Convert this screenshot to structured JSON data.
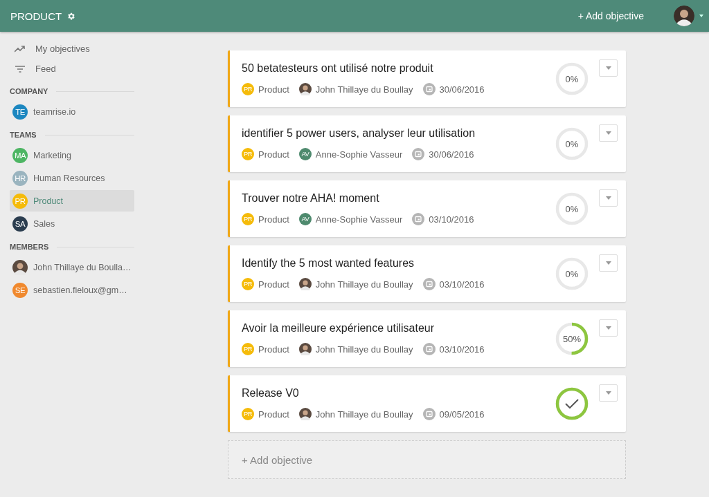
{
  "header": {
    "title": "PRODUCT",
    "add_button": "+ Add objective"
  },
  "sidebar": {
    "nav": [
      {
        "kind": "trend",
        "label": "My objectives"
      },
      {
        "kind": "filter",
        "label": "Feed"
      }
    ],
    "sections": [
      {
        "title": "COMPANY",
        "items": [
          {
            "kind": "initials",
            "initials": "TE",
            "color": "#1c87c0",
            "label": "teamrise.io",
            "selected": false
          }
        ]
      },
      {
        "title": "TEAMS",
        "items": [
          {
            "kind": "initials",
            "initials": "MA",
            "color": "#4db563",
            "label": "Marketing",
            "selected": false
          },
          {
            "kind": "initials",
            "initials": "HR",
            "color": "#9ab4bf",
            "label": "Human Resources",
            "selected": false
          },
          {
            "kind": "initials",
            "initials": "PR",
            "color": "#f5bb0a",
            "label": "Product",
            "selected": true
          },
          {
            "kind": "initials",
            "initials": "SA",
            "color": "#2b3d4f",
            "label": "Sales",
            "selected": false
          }
        ]
      },
      {
        "title": "MEMBERS",
        "items": [
          {
            "kind": "photo",
            "label": "John Thillaye du Boulla…",
            "selected": false
          },
          {
            "kind": "initials",
            "initials": "SE",
            "color": "#f0892e",
            "label": "sebastien.fieloux@gm…",
            "selected": false
          }
        ]
      }
    ]
  },
  "objectives": [
    {
      "title": "50 betatesteurs ont utilisé notre produit",
      "team": {
        "initials": "PR",
        "color": "#f5bb0a",
        "label": "Product"
      },
      "owner": {
        "kind": "photo",
        "label": "John Thillaye du Boullay"
      },
      "date": "30/06/2016",
      "complete": false,
      "level": 0,
      "reading": "0%"
    },
    {
      "title": "identifier 5 power users, analyser leur utilisation",
      "team": {
        "initials": "PR",
        "color": "#f5bb0a",
        "label": "Product"
      },
      "owner": {
        "kind": "initials",
        "initials": "AV",
        "color": "#4e8a6e",
        "label": "Anne-Sophie Vasseur"
      },
      "date": "30/06/2016",
      "complete": false,
      "level": 0,
      "reading": "0%"
    },
    {
      "title": "Trouver notre AHA! moment",
      "team": {
        "initials": "PR",
        "color": "#f5bb0a",
        "label": "Product"
      },
      "owner": {
        "kind": "initials",
        "initials": "AV",
        "color": "#4e8a6e",
        "label": "Anne-Sophie Vasseur"
      },
      "date": "03/10/2016",
      "complete": false,
      "level": 0,
      "reading": "0%"
    },
    {
      "title": "Identify the 5 most wanted features",
      "team": {
        "initials": "PR",
        "color": "#f5bb0a",
        "label": "Product"
      },
      "owner": {
        "kind": "photo",
        "label": "John Thillaye du Boullay"
      },
      "date": "03/10/2016",
      "complete": false,
      "level": 0,
      "reading": "0%"
    },
    {
      "title": "Avoir la meilleure expérience utilisateur",
      "team": {
        "initials": "PR",
        "color": "#f5bb0a",
        "label": "Product"
      },
      "owner": {
        "kind": "photo",
        "label": "John Thillaye du Boullay"
      },
      "date": "03/10/2016",
      "complete": false,
      "level": 0.5,
      "reading": "50%"
    },
    {
      "title": "Release V0",
      "team": {
        "initials": "PR",
        "color": "#f5bb0a",
        "label": "Product"
      },
      "owner": {
        "kind": "photo",
        "label": "John Thillaye du Boullay"
      },
      "date": "09/05/2016",
      "complete": true,
      "level": 1
    }
  ],
  "add_objective": "+ Add objective"
}
